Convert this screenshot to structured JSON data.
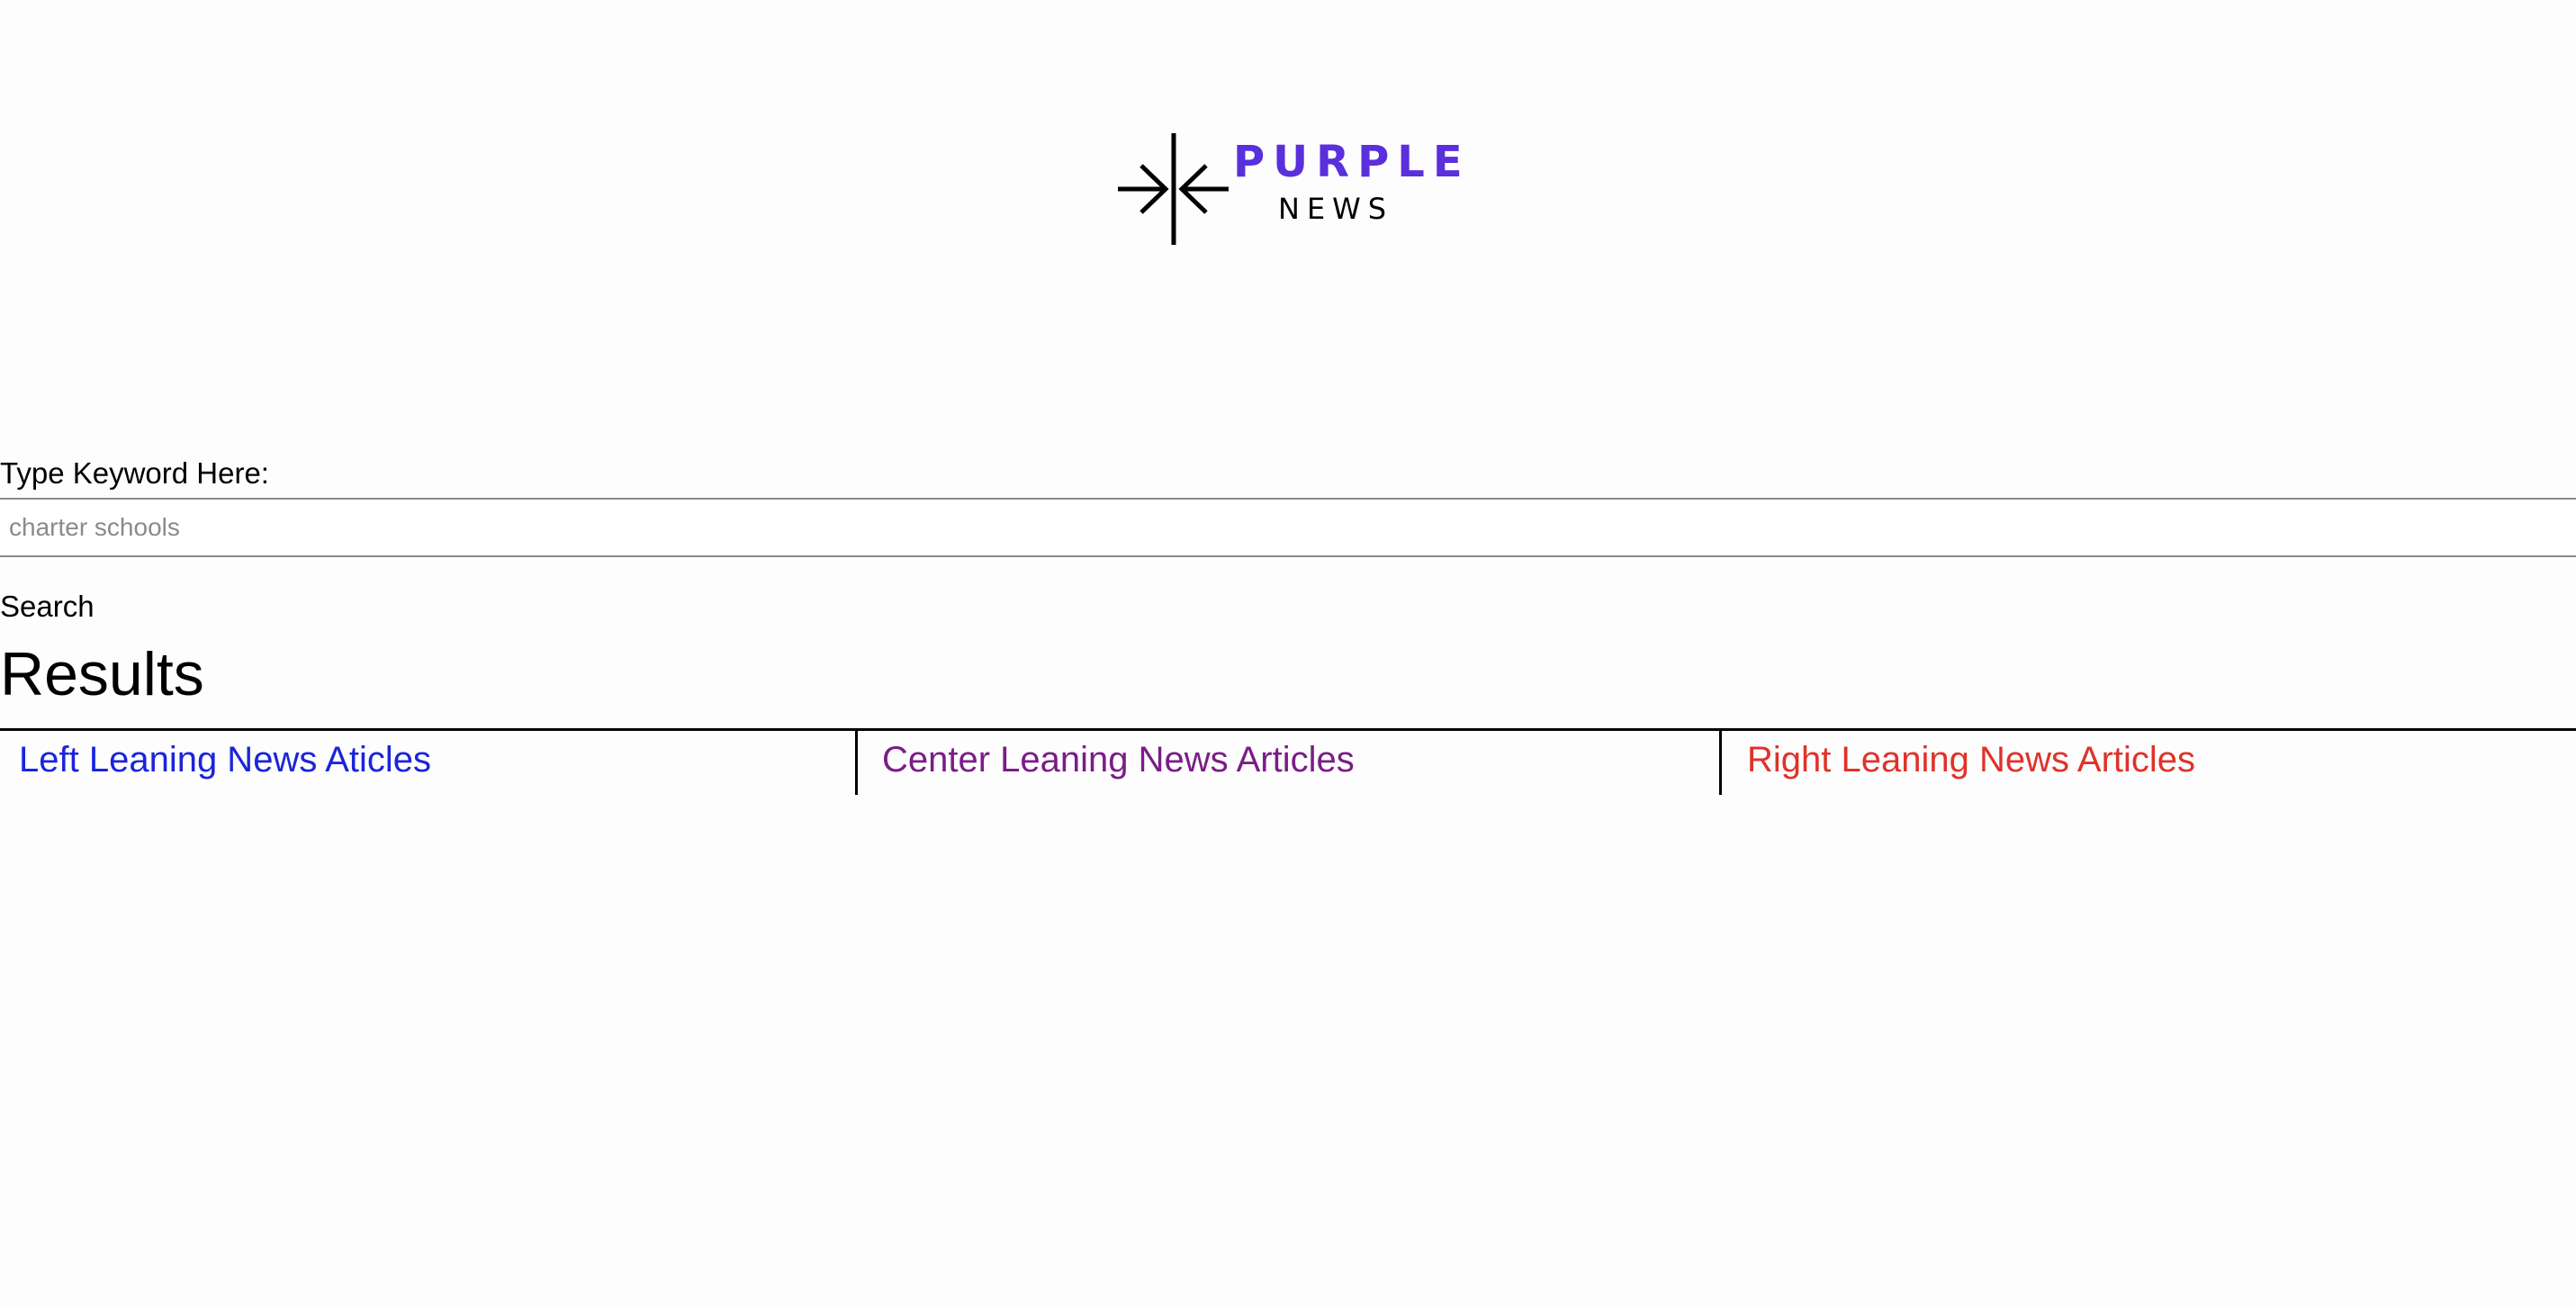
{
  "colors": {
    "brand": "#5a2fdc",
    "left": "#1a24dc",
    "center": "#7a1d86",
    "right": "#e0322a"
  },
  "logo": {
    "icon": "converge-arrows-icon",
    "word": "PURPLE",
    "sub": "NEWS"
  },
  "search": {
    "label": "Type Keyword Here:",
    "value": "",
    "placeholder": "charter schools",
    "button_label": "Search"
  },
  "results": {
    "heading": "Results",
    "columns": [
      {
        "label": "Left Leaning News Aticles"
      },
      {
        "label": "Center Leaning News Articles"
      },
      {
        "label": "Right Leaning News Articles"
      }
    ]
  }
}
